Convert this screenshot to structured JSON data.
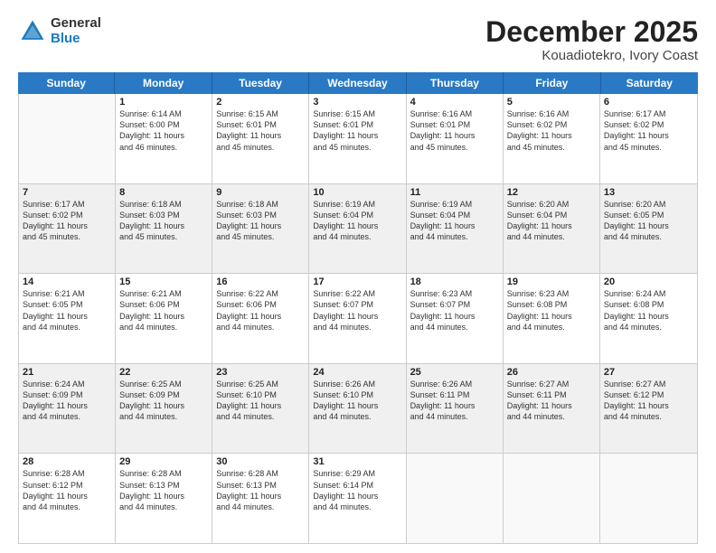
{
  "header": {
    "logo_general": "General",
    "logo_blue": "Blue",
    "title": "December 2025",
    "subtitle": "Kouadiotekro, Ivory Coast"
  },
  "days": [
    "Sunday",
    "Monday",
    "Tuesday",
    "Wednesday",
    "Thursday",
    "Friday",
    "Saturday"
  ],
  "rows": [
    [
      {
        "num": "",
        "info": [],
        "empty": true
      },
      {
        "num": "1",
        "info": [
          "Sunrise: 6:14 AM",
          "Sunset: 6:00 PM",
          "Daylight: 11 hours",
          "and 46 minutes."
        ]
      },
      {
        "num": "2",
        "info": [
          "Sunrise: 6:15 AM",
          "Sunset: 6:01 PM",
          "Daylight: 11 hours",
          "and 45 minutes."
        ]
      },
      {
        "num": "3",
        "info": [
          "Sunrise: 6:15 AM",
          "Sunset: 6:01 PM",
          "Daylight: 11 hours",
          "and 45 minutes."
        ]
      },
      {
        "num": "4",
        "info": [
          "Sunrise: 6:16 AM",
          "Sunset: 6:01 PM",
          "Daylight: 11 hours",
          "and 45 minutes."
        ]
      },
      {
        "num": "5",
        "info": [
          "Sunrise: 6:16 AM",
          "Sunset: 6:02 PM",
          "Daylight: 11 hours",
          "and 45 minutes."
        ]
      },
      {
        "num": "6",
        "info": [
          "Sunrise: 6:17 AM",
          "Sunset: 6:02 PM",
          "Daylight: 11 hours",
          "and 45 minutes."
        ]
      }
    ],
    [
      {
        "num": "7",
        "info": [
          "Sunrise: 6:17 AM",
          "Sunset: 6:02 PM",
          "Daylight: 11 hours",
          "and 45 minutes."
        ]
      },
      {
        "num": "8",
        "info": [
          "Sunrise: 6:18 AM",
          "Sunset: 6:03 PM",
          "Daylight: 11 hours",
          "and 45 minutes."
        ]
      },
      {
        "num": "9",
        "info": [
          "Sunrise: 6:18 AM",
          "Sunset: 6:03 PM",
          "Daylight: 11 hours",
          "and 45 minutes."
        ]
      },
      {
        "num": "10",
        "info": [
          "Sunrise: 6:19 AM",
          "Sunset: 6:04 PM",
          "Daylight: 11 hours",
          "and 44 minutes."
        ]
      },
      {
        "num": "11",
        "info": [
          "Sunrise: 6:19 AM",
          "Sunset: 6:04 PM",
          "Daylight: 11 hours",
          "and 44 minutes."
        ]
      },
      {
        "num": "12",
        "info": [
          "Sunrise: 6:20 AM",
          "Sunset: 6:04 PM",
          "Daylight: 11 hours",
          "and 44 minutes."
        ]
      },
      {
        "num": "13",
        "info": [
          "Sunrise: 6:20 AM",
          "Sunset: 6:05 PM",
          "Daylight: 11 hours",
          "and 44 minutes."
        ]
      }
    ],
    [
      {
        "num": "14",
        "info": [
          "Sunrise: 6:21 AM",
          "Sunset: 6:05 PM",
          "Daylight: 11 hours",
          "and 44 minutes."
        ]
      },
      {
        "num": "15",
        "info": [
          "Sunrise: 6:21 AM",
          "Sunset: 6:06 PM",
          "Daylight: 11 hours",
          "and 44 minutes."
        ]
      },
      {
        "num": "16",
        "info": [
          "Sunrise: 6:22 AM",
          "Sunset: 6:06 PM",
          "Daylight: 11 hours",
          "and 44 minutes."
        ]
      },
      {
        "num": "17",
        "info": [
          "Sunrise: 6:22 AM",
          "Sunset: 6:07 PM",
          "Daylight: 11 hours",
          "and 44 minutes."
        ]
      },
      {
        "num": "18",
        "info": [
          "Sunrise: 6:23 AM",
          "Sunset: 6:07 PM",
          "Daylight: 11 hours",
          "and 44 minutes."
        ]
      },
      {
        "num": "19",
        "info": [
          "Sunrise: 6:23 AM",
          "Sunset: 6:08 PM",
          "Daylight: 11 hours",
          "and 44 minutes."
        ]
      },
      {
        "num": "20",
        "info": [
          "Sunrise: 6:24 AM",
          "Sunset: 6:08 PM",
          "Daylight: 11 hours",
          "and 44 minutes."
        ]
      }
    ],
    [
      {
        "num": "21",
        "info": [
          "Sunrise: 6:24 AM",
          "Sunset: 6:09 PM",
          "Daylight: 11 hours",
          "and 44 minutes."
        ]
      },
      {
        "num": "22",
        "info": [
          "Sunrise: 6:25 AM",
          "Sunset: 6:09 PM",
          "Daylight: 11 hours",
          "and 44 minutes."
        ]
      },
      {
        "num": "23",
        "info": [
          "Sunrise: 6:25 AM",
          "Sunset: 6:10 PM",
          "Daylight: 11 hours",
          "and 44 minutes."
        ]
      },
      {
        "num": "24",
        "info": [
          "Sunrise: 6:26 AM",
          "Sunset: 6:10 PM",
          "Daylight: 11 hours",
          "and 44 minutes."
        ]
      },
      {
        "num": "25",
        "info": [
          "Sunrise: 6:26 AM",
          "Sunset: 6:11 PM",
          "Daylight: 11 hours",
          "and 44 minutes."
        ]
      },
      {
        "num": "26",
        "info": [
          "Sunrise: 6:27 AM",
          "Sunset: 6:11 PM",
          "Daylight: 11 hours",
          "and 44 minutes."
        ]
      },
      {
        "num": "27",
        "info": [
          "Sunrise: 6:27 AM",
          "Sunset: 6:12 PM",
          "Daylight: 11 hours",
          "and 44 minutes."
        ]
      }
    ],
    [
      {
        "num": "28",
        "info": [
          "Sunrise: 6:28 AM",
          "Sunset: 6:12 PM",
          "Daylight: 11 hours",
          "and 44 minutes."
        ]
      },
      {
        "num": "29",
        "info": [
          "Sunrise: 6:28 AM",
          "Sunset: 6:13 PM",
          "Daylight: 11 hours",
          "and 44 minutes."
        ]
      },
      {
        "num": "30",
        "info": [
          "Sunrise: 6:28 AM",
          "Sunset: 6:13 PM",
          "Daylight: 11 hours",
          "and 44 minutes."
        ]
      },
      {
        "num": "31",
        "info": [
          "Sunrise: 6:29 AM",
          "Sunset: 6:14 PM",
          "Daylight: 11 hours",
          "and 44 minutes."
        ]
      },
      {
        "num": "",
        "info": [],
        "empty": true
      },
      {
        "num": "",
        "info": [],
        "empty": true
      },
      {
        "num": "",
        "info": [],
        "empty": true
      }
    ]
  ]
}
